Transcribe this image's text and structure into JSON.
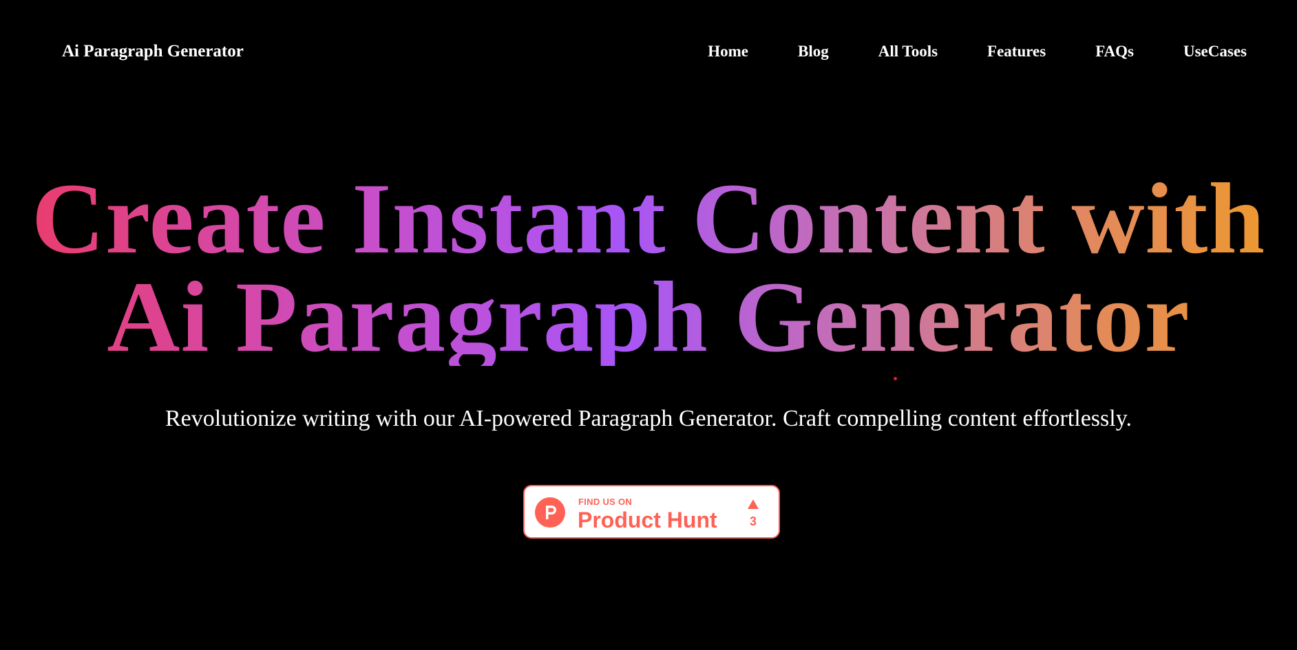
{
  "nav": {
    "brand": "Ai Paragraph Generator",
    "links": [
      "Home",
      "Blog",
      "All Tools",
      "Features",
      "FAQs",
      "UseCases"
    ]
  },
  "hero": {
    "title_line1": "Create Instant Content with",
    "title_line2": "Ai Paragraph Generator",
    "subtitle": "Revolutionize writing with our AI-powered Paragraph Generator. Craft compelling content effortlessly."
  },
  "product_hunt": {
    "find_label": "FIND US ON",
    "name": "Product Hunt",
    "logo_letter": "P",
    "upvote_count": "3",
    "icons": [
      "product-hunt-logo-icon",
      "upvote-arrow-icon"
    ]
  },
  "colors": {
    "background": "#000000",
    "text": "#ffffff",
    "gradient_start": "#ec3b66",
    "gradient_mid": "#a855f7",
    "gradient_end": "#ef9b29",
    "product_hunt": "#ff6154"
  }
}
